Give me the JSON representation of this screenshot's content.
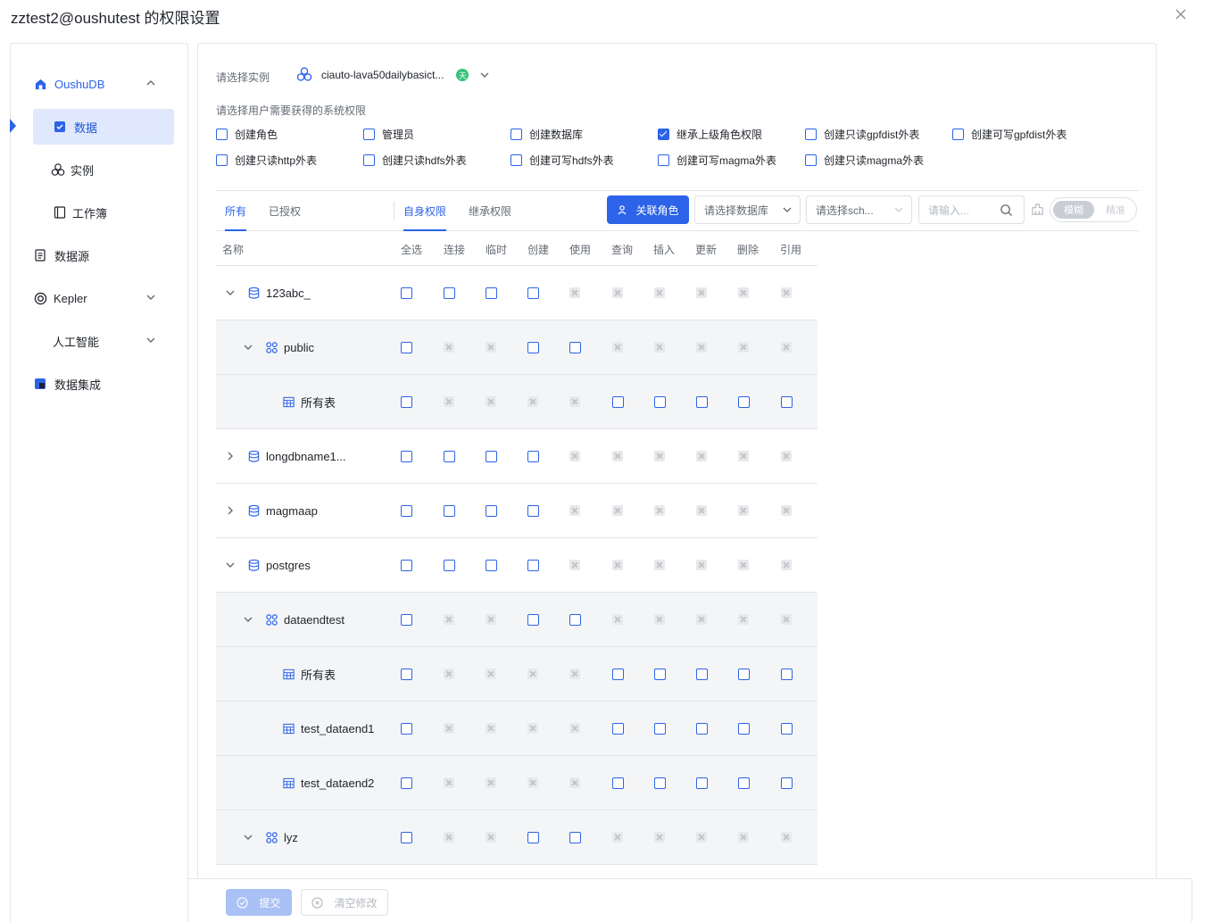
{
  "dialog": {
    "title": "zztest2@oushutest 的权限设置"
  },
  "sidebar": {
    "items": [
      {
        "label": "OushuDB"
      },
      {
        "label": "数据"
      },
      {
        "label": "实例"
      },
      {
        "label": "工作簿"
      },
      {
        "label": "数据源"
      },
      {
        "label": "Kepler"
      },
      {
        "label": "人工智能"
      },
      {
        "label": "数据集成"
      }
    ]
  },
  "instance": {
    "label": "请选择实例",
    "value": "ciauto-lava50dailybasict...",
    "badge": "天"
  },
  "system_perms": {
    "label": "请选择用户需要获得的系统权限",
    "items": [
      {
        "label": "创建角色",
        "checked": false
      },
      {
        "label": "管理员",
        "checked": false
      },
      {
        "label": "创建数据库",
        "checked": false
      },
      {
        "label": "继承上级角色权限",
        "checked": true
      },
      {
        "label": "创建只读gpfdist外表",
        "checked": false
      },
      {
        "label": "创建可写gpfdist外表",
        "checked": false
      },
      {
        "label": "创建只读http外表",
        "checked": false
      },
      {
        "label": "创建只读hdfs外表",
        "checked": false
      },
      {
        "label": "创建可写hdfs外表",
        "checked": false
      },
      {
        "label": "创建可写magma外表",
        "checked": false
      },
      {
        "label": "创建只读magma外表",
        "checked": false
      }
    ]
  },
  "tabs": {
    "left": [
      {
        "label": "所有"
      },
      {
        "label": "已授权"
      }
    ],
    "right": [
      {
        "label": "自身权限"
      },
      {
        "label": "继承权限"
      }
    ]
  },
  "toolbar": {
    "link_role": "关联角色",
    "db_placeholder": "请选择数据库",
    "schema_placeholder": "请选择sch...",
    "search_placeholder": "请输入...",
    "mode_fuzzy": "模糊",
    "mode_exact": "精准"
  },
  "table": {
    "headers": [
      "名称",
      "全选",
      "连接",
      "临时",
      "创建",
      "使用",
      "查询",
      "插入",
      "更新",
      "删除",
      "引用"
    ],
    "rows": [
      {
        "name": "123abc_",
        "type": "database",
        "level": 0,
        "expander": "down",
        "cells": "ccccdddddd"
      },
      {
        "name": "public",
        "type": "schema",
        "level": 1,
        "expander": "down",
        "cells": "cddccddddd"
      },
      {
        "name": "所有表",
        "type": "table",
        "level": 2,
        "expander": "",
        "cells": "cddddccccc"
      },
      {
        "name": "longdbname1...",
        "type": "database",
        "level": 0,
        "expander": "right",
        "cells": "ccccdddddd"
      },
      {
        "name": "magmaap",
        "type": "database",
        "level": 0,
        "expander": "right",
        "cells": "ccccdddddd"
      },
      {
        "name": "postgres",
        "type": "database",
        "level": 0,
        "expander": "down",
        "cells": "ccccdddddd"
      },
      {
        "name": "dataendtest",
        "type": "schema",
        "level": 1,
        "expander": "down",
        "cells": "cddccddddd"
      },
      {
        "name": "所有表",
        "type": "table",
        "level": 2,
        "expander": "",
        "cells": "cddddccccc"
      },
      {
        "name": "test_dataend1",
        "type": "table",
        "level": 2,
        "expander": "",
        "cells": "cddddccccc"
      },
      {
        "name": "test_dataend2",
        "type": "table",
        "level": 2,
        "expander": "",
        "cells": "cddddccccc"
      },
      {
        "name": "lyz",
        "type": "schema",
        "level": 1,
        "expander": "down",
        "cells": "cddccddddd"
      }
    ]
  },
  "footer": {
    "submit": "提交",
    "clear": "清空修改"
  },
  "colors": {
    "accent": "#2c63e8",
    "active_bg": "#dfe8fc",
    "row_shade": "#f4f5f7"
  }
}
